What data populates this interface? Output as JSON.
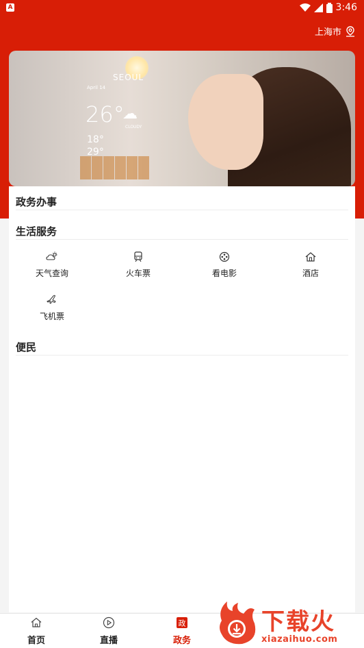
{
  "status_bar": {
    "app_badge": "A",
    "time": "3:46"
  },
  "header": {
    "location": "上海市"
  },
  "banner": {
    "city": "SEOUL",
    "date": "April 14",
    "temp": "26°",
    "condition": "CLOUDY",
    "low": "18°",
    "high": "29°"
  },
  "sections": {
    "gov": {
      "title": "政务办事"
    },
    "life": {
      "title": "生活服务",
      "items": [
        {
          "label": "天气查询",
          "icon": "weather-icon"
        },
        {
          "label": "火车票",
          "icon": "train-icon"
        },
        {
          "label": "看电影",
          "icon": "movie-icon"
        },
        {
          "label": "酒店",
          "icon": "hotel-icon"
        },
        {
          "label": "飞机票",
          "icon": "plane-icon"
        }
      ]
    },
    "convenience": {
      "title": "便民"
    }
  },
  "tabbar": {
    "tabs": [
      {
        "label": "首页",
        "icon": "home-icon"
      },
      {
        "label": "直播",
        "icon": "play-icon"
      },
      {
        "label": "政务",
        "icon": "gov-icon",
        "icon_text": "政"
      }
    ]
  },
  "watermark": {
    "title": "下载火",
    "subtitle": "xiazaihuo.com"
  },
  "colors": {
    "brand_red": "#d81e06",
    "watermark_orange": "#e8432a"
  }
}
